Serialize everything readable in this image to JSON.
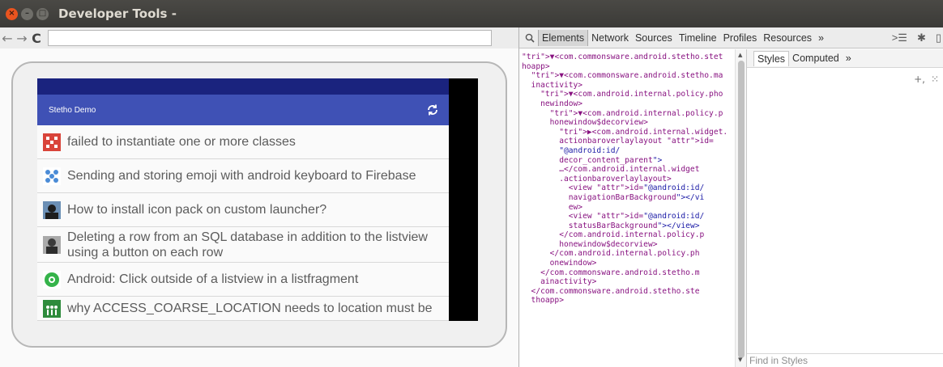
{
  "window": {
    "title": "Developer Tools -"
  },
  "nav": {
    "back_icon": "back-arrow-icon",
    "forward_icon": "forward-arrow-icon",
    "reload_icon": "reload-icon",
    "url": ""
  },
  "app": {
    "title": "Stetho Demo",
    "refresh_icon": "refresh-icon",
    "colors": {
      "status_bar": "#1a237e",
      "app_bar": "#3f51b5"
    },
    "items": [
      {
        "text": "failed to instantiate one or more classes",
        "icon": "red-identicon"
      },
      {
        "text": "Sending and storing emoji with android keyboard to Firebase",
        "icon": "blue-identicon"
      },
      {
        "text": "How to install icon pack on custom launcher?",
        "icon": "user-photo-avatar"
      },
      {
        "text": "Deleting a row from an SQL database in addition to the listview using a button on each row",
        "icon": "user-photo-avatar"
      },
      {
        "text": "Android: Click outside of a listview in a listfragment",
        "icon": "green-identicon"
      },
      {
        "text": "why ACCESS_COARSE_LOCATION needs to location must be",
        "icon": "green-people-icon"
      }
    ]
  },
  "devtools": {
    "tabs": [
      "Elements",
      "Network",
      "Sources",
      "Timeline",
      "Profiles",
      "Resources"
    ],
    "active_tab": "Elements",
    "more_tabs": "»",
    "dom_lines": [
      "▼<com.commonsware.android.stetho.stet",
      "hoapp>",
      "  ▼<com.commonsware.android.stetho.ma",
      "  inactivity>",
      "    ▼<com.android.internal.policy.pho",
      "    newindow>",
      "      ▼<com.android.internal.policy.p",
      "      honewindow$decorview>",
      "        ▶<com.android.internal.widget.",
      "        actionbaroverlaylayout id=",
      "        \"@android:id/",
      "        decor_content_parent\">",
      "        …</com.android.internal.widget",
      "        .actionbaroverlaylayout>",
      "          <view id=\"@android:id/",
      "          navigationBarBackground\"></vi",
      "          ew>",
      "          <view id=\"@android:id/",
      "          statusBarBackground\"></view>",
      "        </com.android.internal.policy.p",
      "        honewindow$decorview>",
      "      </com.android.internal.policy.ph",
      "      onewindow>",
      "    </com.commonsware.android.stetho.m",
      "    ainactivity>",
      "  </com.commonsware.android.stetho.ste",
      "  thoapp>"
    ],
    "styles": {
      "tabs": [
        "Styles",
        "Computed"
      ],
      "active_tab": "Styles",
      "more_tabs": "»",
      "find_placeholder": "Find in Styles"
    }
  }
}
